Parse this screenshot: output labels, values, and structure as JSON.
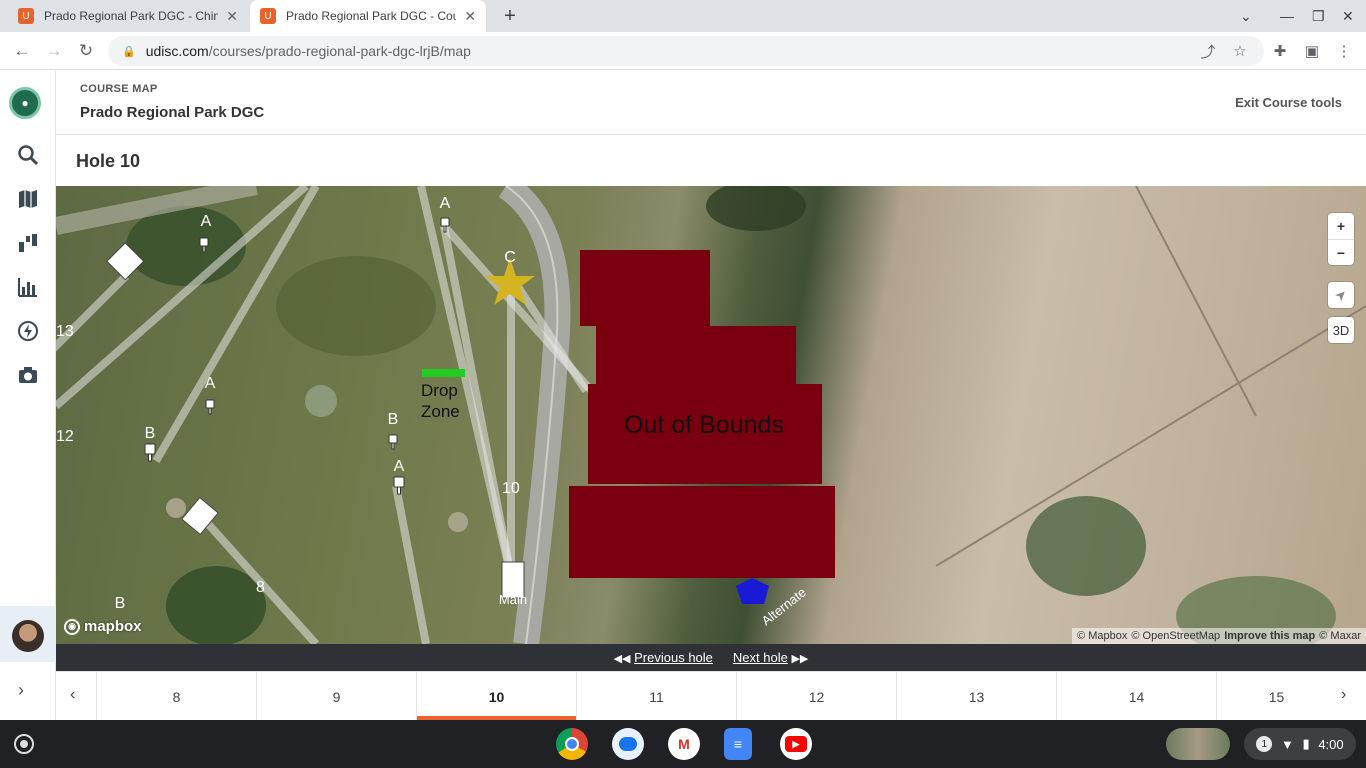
{
  "browser": {
    "tabs": [
      {
        "title": "Prado Regional Park DGC - Chino",
        "active": false
      },
      {
        "title": "Prado Regional Park DGC - Course",
        "active": true
      }
    ],
    "new_tab": "+",
    "url_host": "udisc.com",
    "url_path": "/courses/prado-regional-park-dgc-lrjB/map",
    "icons": [
      "back-icon",
      "forward-icon",
      "reload-icon",
      "lock-icon",
      "share-icon",
      "star-icon",
      "extensions-icon",
      "side-panel-icon",
      "menu-icon"
    ]
  },
  "sidebar": {
    "items": [
      {
        "name": "logo-icon"
      },
      {
        "name": "search-icon"
      },
      {
        "name": "map-icon"
      },
      {
        "name": "layout-icon"
      },
      {
        "name": "stats-icon"
      },
      {
        "name": "events-icon"
      },
      {
        "name": "camera-icon"
      }
    ],
    "expand": "›"
  },
  "header": {
    "kicker": "COURSE MAP",
    "course_name": "Prado Regional Park DGC",
    "exit_label": "Exit Course tools"
  },
  "hole": {
    "title": "Hole 10"
  },
  "map": {
    "labels": {
      "drop_zone_line1": "Drop",
      "drop_zone_line2": "Zone",
      "out_of_bounds": "Out of Bounds",
      "main": "Main",
      "alternate": "Alternate",
      "hole_10": "10",
      "hole_13": "13",
      "hole_12": "12",
      "hole_8": "8",
      "pin_a1": "A",
      "pin_a2": "A",
      "pin_a3": "A",
      "pin_a4": "A",
      "pin_b1": "B",
      "pin_b2": "B",
      "pin_b3": "B",
      "pin_c": "C"
    },
    "zoom_in": "+",
    "zoom_out": "−",
    "compass": "➤",
    "three_d": "3D",
    "logo_text": "mapbox",
    "attribution": {
      "mapbox": "© Mapbox",
      "osm": "© OpenStreetMap",
      "improve": "Improve this map",
      "maxar": "© Maxar"
    },
    "colors": {
      "out_of_bounds": "#7a0010",
      "drop_zone": "#22cc22",
      "basket_star": "#d4b41f",
      "alternate_tee": "#1a1ad6"
    }
  },
  "nav": {
    "previous_label": "Previous hole",
    "next_label": "Next hole"
  },
  "hole_strip": {
    "holes": [
      "8",
      "9",
      "10",
      "11",
      "12",
      "13",
      "14",
      "15"
    ],
    "active": "10"
  },
  "shelf": {
    "apps": [
      {
        "name": "chrome-icon"
      },
      {
        "name": "messages-icon"
      },
      {
        "name": "gmail-icon"
      },
      {
        "name": "docs-icon"
      },
      {
        "name": "youtube-icon"
      }
    ],
    "notification_count": "1",
    "time": "4:00"
  }
}
